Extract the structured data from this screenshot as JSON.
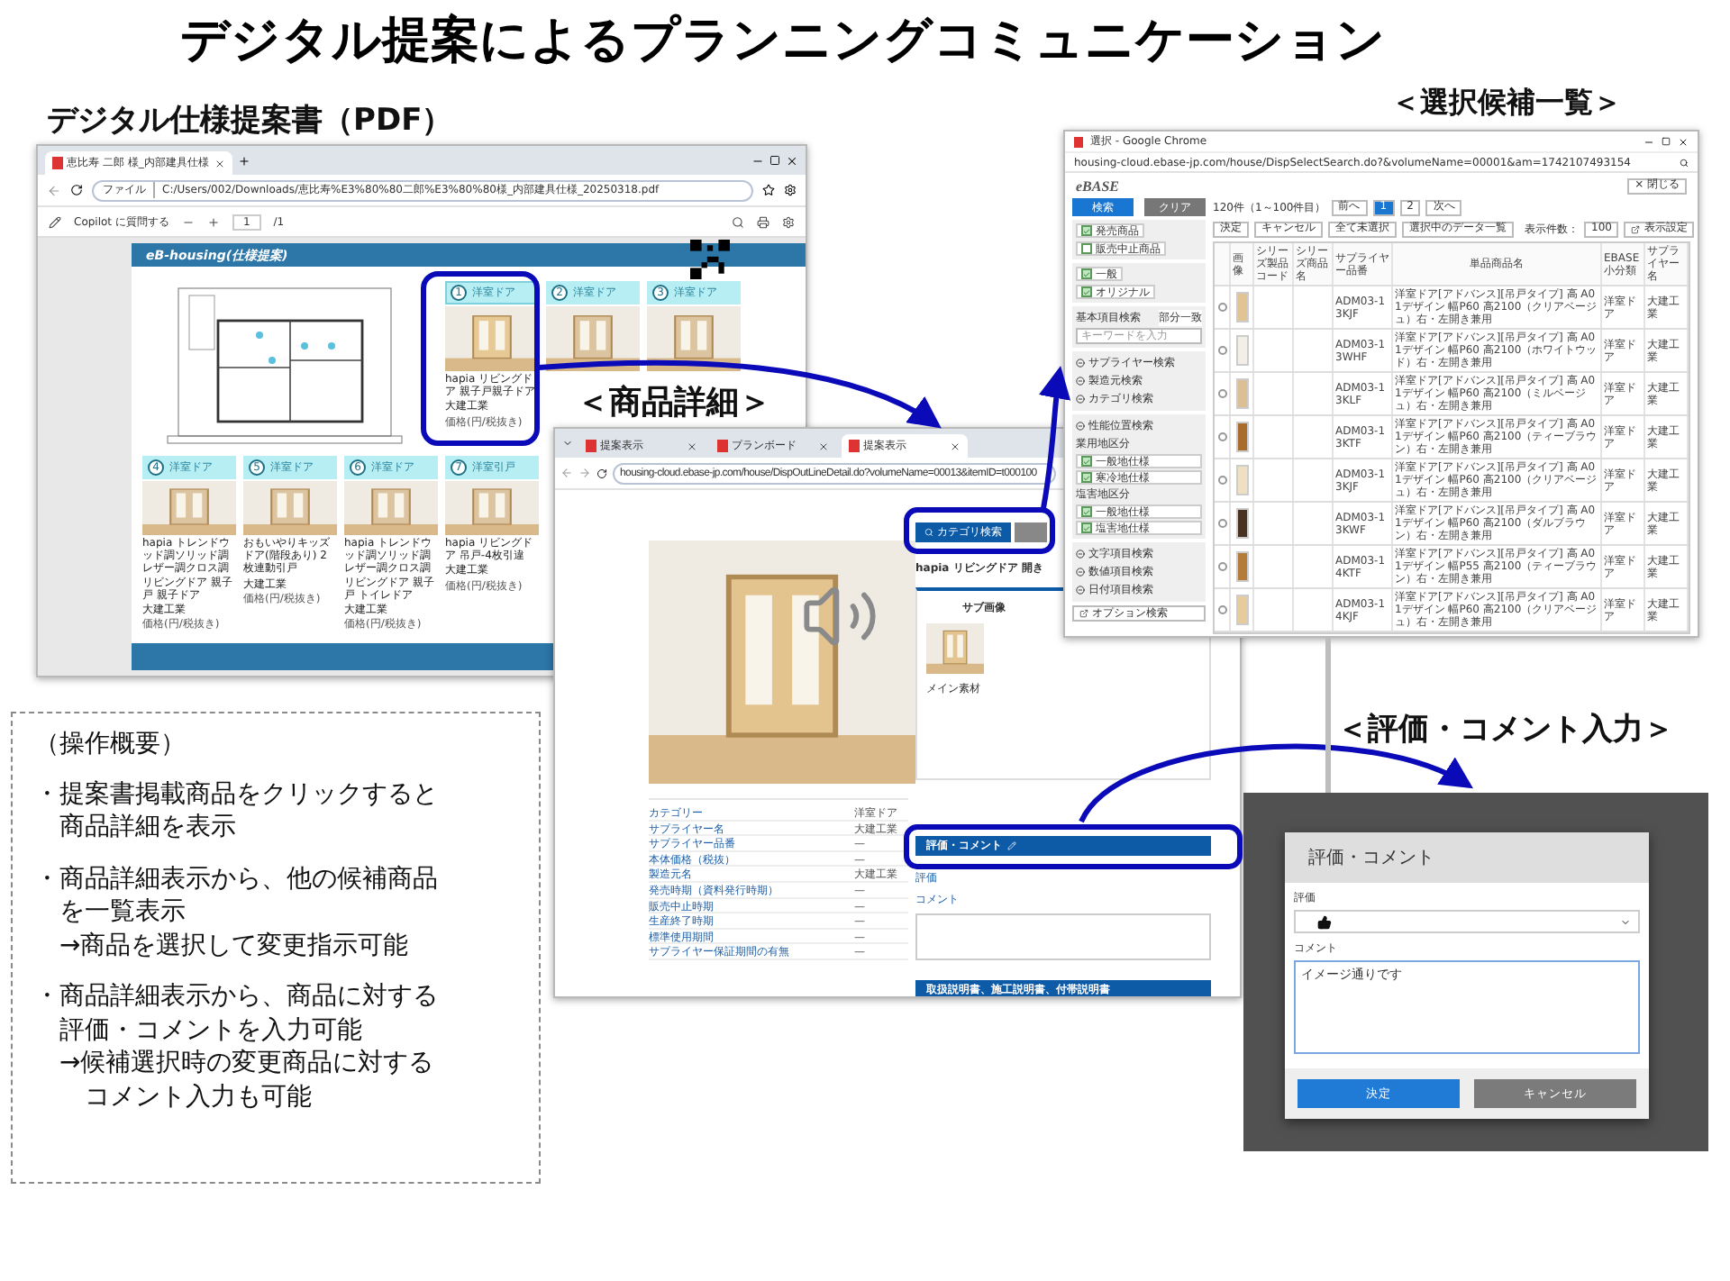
{
  "title": "デジタル提案によるプランニングコミュニケーション",
  "labels": {
    "pdf": "デジタル仕様提案書（PDF）",
    "candidates": "＜選択候補一覧＞",
    "detail": "＜商品詳細＞",
    "comment": "＜評価・コメント入力＞"
  },
  "pdf_window": {
    "tabs": [
      {
        "label": "恵比寿 二郎 様_内部建具仕様",
        "selected": true
      }
    ],
    "address_prefix": "ファイル",
    "address": "C:/Users/002/Downloads/恵比寿%E3%80%80二郎%E3%80%80様_内部建具仕様_20250318.pdf",
    "copilot": "Copilot に質問する",
    "page": "1",
    "page_total": "/1",
    "document": {
      "header": "eB-housing(仕様提案)",
      "cards_top": [
        {
          "number": "1",
          "category": "洋室ドア",
          "name": "hapia リビングドア 親子戸親子ドア",
          "maker": "大建工業",
          "note": "価格(円/税抜き)",
          "highlighted": true
        },
        {
          "number": "2",
          "category": "洋室ドア",
          "highlighted": false
        },
        {
          "number": "3",
          "category": "洋室ドア",
          "highlighted": false
        }
      ],
      "cards_bottom": [
        {
          "number": "4",
          "category": "洋室ドア",
          "name": "hapia トレンドウッド調ソリッド調レザー調クロス調リビングドア 親子戸 親子ドア",
          "maker": "大建工業",
          "note": "価格(円/税抜き)",
          "highlighted": false
        },
        {
          "number": "5",
          "category": "洋室ドア",
          "name": "おもいやりキッズドア(階段あり) 2枚連動引戸",
          "maker": "大建工業",
          "note": "価格(円/税抜き)",
          "highlighted": false
        },
        {
          "number": "6",
          "category": "洋室ドア",
          "name": "hapia トレンドウッド調ソリッド調レザー調クロス調リビングドア 親子戸 トイレドア",
          "maker": "大建工業",
          "note": "価格(円/税抜き)",
          "highlighted": false
        },
        {
          "number": "7",
          "category": "洋室引戸",
          "name": "hapia リビングドア 吊戸-4枚引違",
          "maker": "大建工業",
          "note": "価格(円/税抜き)",
          "highlighted": false
        }
      ]
    }
  },
  "detail_window": {
    "tabs": [
      {
        "label": "提案表示",
        "selected": false
      },
      {
        "label": "プランボード",
        "selected": false
      },
      {
        "label": "提案表示",
        "selected": true
      }
    ],
    "address": "housing-cloud.ebase-jp.com/house/DispOutLineDetail.do?volumeName=00013&itemID=t000100",
    "category_button": "カテゴリ検索",
    "product_name": "hapia リビングドア 開き",
    "sub_image_tab": "サブ画像",
    "thumb_caption": "メイン素材",
    "specs": [
      {
        "label": "カテゴリー",
        "value": "洋室ドア"
      },
      {
        "label": "サプライヤー名",
        "value": "大建工業"
      },
      {
        "label": "サプライヤー品番",
        "value": "—"
      },
      {
        "label": "本体価格（税抜）",
        "value": "—"
      },
      {
        "label": "製造元名",
        "value": "大建工業"
      },
      {
        "label": "発売時期（資料発行時期）",
        "value": "—"
      },
      {
        "label": "販売中止時期",
        "value": "—"
      },
      {
        "label": "生産終了時期",
        "value": "—"
      },
      {
        "label": "標準使用期間",
        "value": "—"
      },
      {
        "label": "サプライヤー保証期間の有無",
        "value": "—"
      }
    ],
    "comment_panel": {
      "title": "評価・コメント",
      "rating_label": "評価",
      "comment_label": "コメント"
    },
    "docs_title": "取扱説明書、施工説明書、付帯説明書"
  },
  "list_window": {
    "title": "選択 - Google Chrome",
    "address": "housing-cloud.ebase-jp.com/house/DispSelectSearch.do?&volumeName=00001&am=1742107493154",
    "logo": "eBASE",
    "close": "× 閉じる",
    "search_button": "検索",
    "clear_button": "クリア",
    "filters": [
      {
        "label": "発売商品",
        "checked": true
      },
      {
        "label": "販売中止商品",
        "checked": false
      }
    ],
    "types": [
      {
        "label": "一般",
        "checked": true
      },
      {
        "label": "オリジナル",
        "checked": true
      }
    ],
    "keyword": {
      "label": "基本項目検索",
      "mode": "部分一致",
      "placeholder": "キーワードを入力"
    },
    "sections": [
      "サプライヤー検索",
      "製造元検索",
      "カテゴリ検索"
    ],
    "detail_search": {
      "title": "性能位置検索",
      "groups": [
        {
          "label": "業用地区分",
          "options": [
            {
              "label": "一般地仕様",
              "checked": true
            },
            {
              "label": "寒冷地仕様",
              "checked": true
            }
          ]
        },
        {
          "label": "塩害地区分",
          "options": [
            {
              "label": "一般地仕様",
              "checked": true
            },
            {
              "label": "塩害地仕様",
              "checked": true
            }
          ]
        }
      ]
    },
    "sections_more": [
      "文字項目検索",
      "数値項目検索",
      "日付項目検索"
    ],
    "option_search": "オプション検索",
    "count": "120件（1～100件目）",
    "prev": "前へ",
    "pages": [
      {
        "label": "1",
        "selected": true
      },
      {
        "label": "2",
        "selected": false
      }
    ],
    "next": "次へ",
    "actions": [
      "決定",
      "キャンセル",
      "全て未選択",
      "選択中のデータ一覧"
    ],
    "per_page_label": "表示件数：",
    "per_page": "100",
    "display_settings": "表示設定",
    "columns": [
      "画像",
      "シリーズ製品コード",
      "シリーズ商品名",
      "サプライヤー品番",
      "単品商品名",
      "EBASE小分類",
      "サプライヤー名"
    ],
    "rows": [
      {
        "color": "#e2c394",
        "code": "ADM03-13KJF",
        "name": "洋室ドア[アドバンス][吊戸タイプ] 高 A01デザイン 幅P60 高2100（クリアベージュ）右・左開き兼用",
        "class": "洋室ドア",
        "supplier": "大建工業",
        "selected": false
      },
      {
        "color": "#f3eee6",
        "code": "ADM03-13WHF",
        "name": "洋室ドア[アドバンス][吊戸タイプ] 高 A01デザイン 幅P60 高2100（ホワイトウッド）右・左開き兼用",
        "class": "洋室ドア",
        "supplier": "大建工業",
        "selected": false
      },
      {
        "color": "#dcbf95",
        "code": "ADM03-13KLF",
        "name": "洋室ドア[アドバンス][吊戸タイプ] 高 A01デザイン 幅P60 高2100（ミルベージュ）右・左開き兼用",
        "class": "洋室ドア",
        "supplier": "大建工業",
        "selected": false
      },
      {
        "color": "#a86d2c",
        "code": "ADM03-13KTF",
        "name": "洋室ドア[アドバンス][吊戸タイプ] 高 A01デザイン 幅P60 高2100（ティーブラウン）右・左開き兼用",
        "class": "洋室ドア",
        "supplier": "大建工業",
        "selected": false
      },
      {
        "color": "#efe0c2",
        "code": "ADM03-13KJF",
        "name": "洋室ドア[アドバンス][吊戸タイプ] 高 A01デザイン 幅P60 高2100（クリアベージュ）右・左開き兼用",
        "class": "洋室ドア",
        "supplier": "大建工業",
        "selected": false
      },
      {
        "color": "#4a3222",
        "code": "ADM03-13KWF",
        "name": "洋室ドア[アドバンス][吊戸タイプ] 高 A01デザイン 幅P60 高2100（ダルブラウン）右・左開き兼用",
        "class": "洋室ドア",
        "supplier": "大建工業",
        "selected": false
      },
      {
        "color": "#b57b3a",
        "code": "ADM03-14KTF",
        "name": "洋室ドア[アドバンス][吊戸タイプ] 高 A01デザイン 幅P55 高2100（ティーブラウン）右・左開き兼用",
        "class": "洋室ドア",
        "supplier": "大建工業",
        "selected": false
      },
      {
        "color": "#e6cc9c",
        "code": "ADM03-14KJF",
        "name": "洋室ドア[アドバンス][吊戸タイプ] 高 A01デザイン 幅P60 高2100（クリアベージュ）右・左開き兼用",
        "class": "洋室ドア",
        "supplier": "大建工業",
        "selected": false
      }
    ]
  },
  "comment_dialog": {
    "title": "評価・コメント",
    "rating_label": "評価",
    "comment_label": "コメント",
    "comment": "イメージ通りです",
    "ok": "決定",
    "cancel": "キャンセル"
  },
  "notes": {
    "heading": "（操作概要）",
    "items": [
      {
        "bullet": "・",
        "text": "提案書掲載商品をクリックすると商品詳細を表示"
      },
      {
        "bullet": "・",
        "text": "商品詳細表示から、他の候補商品を一覧表示",
        "note": "→商品を選択して変更指示可能"
      },
      {
        "bullet": "・",
        "text": "商品詳細表示から、商品に対する評価・コメントを入力可能",
        "note": "→候補選択時の変更商品に対するコメント入力も可能"
      }
    ]
  }
}
